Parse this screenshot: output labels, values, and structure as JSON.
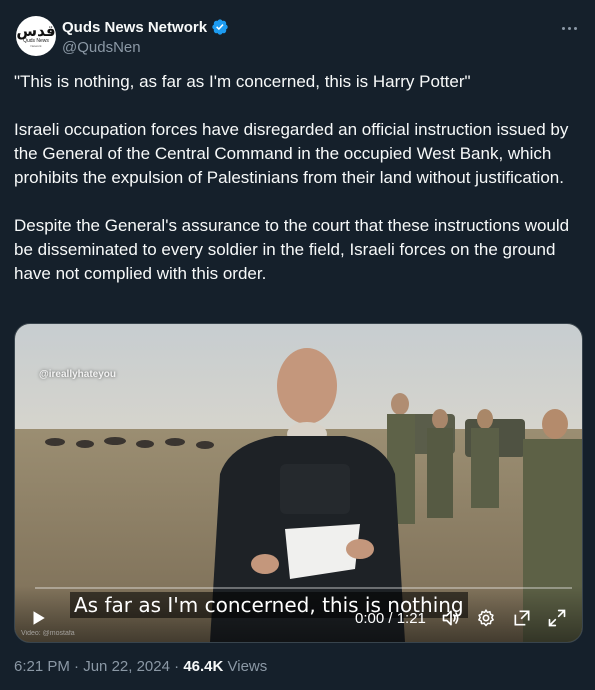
{
  "author": {
    "name": "Quds News Network",
    "handle": "@QudsNen",
    "logo_text": "ﻗﺪﺱ",
    "logo_sub": "Quds News",
    "logo_sub2": "Network",
    "verified_color": "#1d9bf0"
  },
  "tweet": {
    "paragraphs": [
      "\"This is nothing, as far as I'm concerned, this is Harry Potter\"",
      "Israeli occupation forces have disregarded an official instruction issued by the General of the Central Command in the occupied West Bank, which prohibits the expulsion of Palestinians from their land without justification.",
      "Despite the General's assurance to the court that these instructions would be disseminated to every soldier in the field, Israeli forces on the ground have not complied with this order."
    ]
  },
  "video": {
    "watermark": "@ireallyhateyou",
    "subtitle": "As far as I'm concerned, this is nothing",
    "credit": "Video: @mostafa",
    "time": "0:00 / 1:21",
    "progress": 0,
    "icons": [
      "play-icon",
      "volume-icon",
      "settings-icon",
      "pip-icon",
      "fullscreen-icon"
    ]
  },
  "footer": {
    "time": "6:21 PM",
    "date": "Jun 22, 2024",
    "views": "46.4K",
    "views_label": "Views",
    "separator": "·"
  },
  "colors": {
    "background": "#15202b",
    "text": "#f7f9f9",
    "secondary": "#8b98a5",
    "border": "#38444d"
  }
}
